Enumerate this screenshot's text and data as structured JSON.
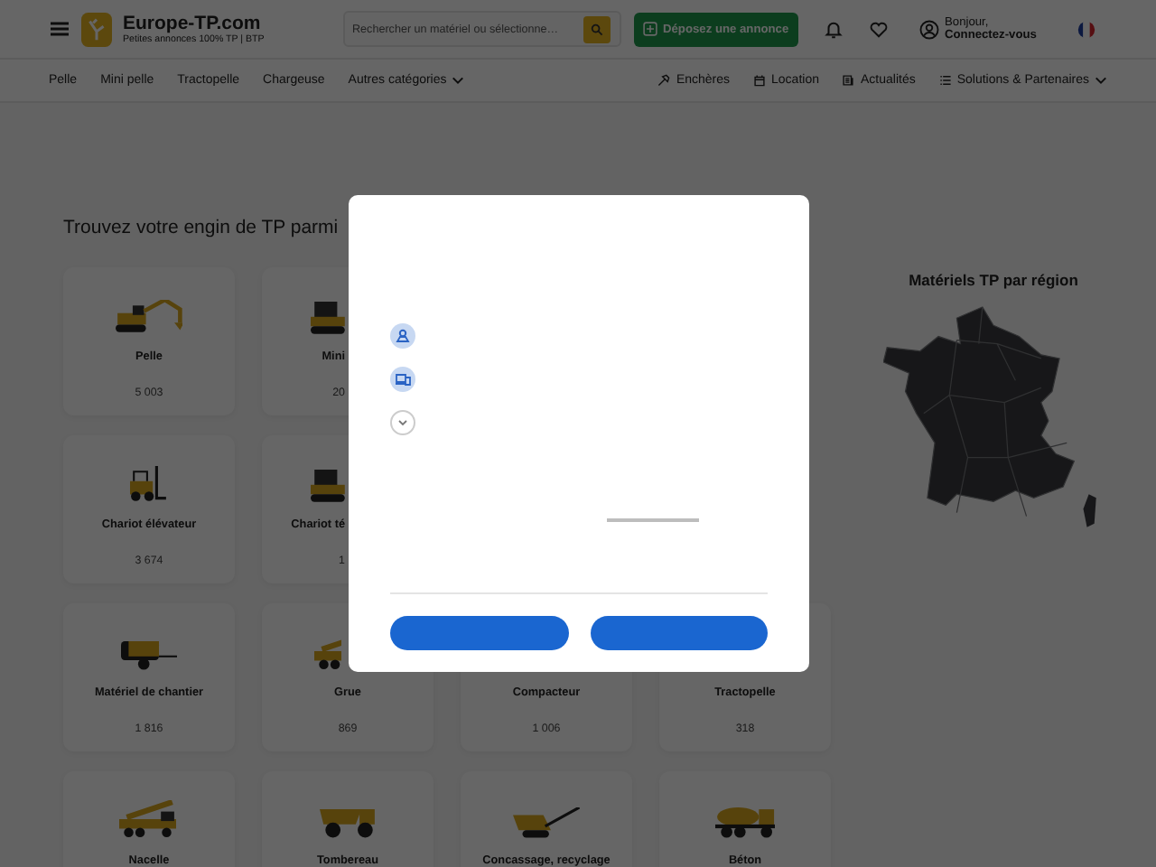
{
  "header": {
    "logo_title": "Europe-TP.com",
    "logo_subtitle": "Petites annonces 100% TP | BTP",
    "search": {
      "placeholder": "Rechercher un matériel ou sélectionne…"
    },
    "post_button": "Déposez une annonce",
    "greeting": "Bonjour,",
    "login": "Connectez-vous"
  },
  "nav": {
    "left": [
      {
        "label": "Pelle",
        "dropdown": false
      },
      {
        "label": "Mini pelle",
        "dropdown": false
      },
      {
        "label": "Tractopelle",
        "dropdown": false
      },
      {
        "label": "Chargeuse",
        "dropdown": false
      },
      {
        "label": "Autres catégories",
        "dropdown": true
      }
    ],
    "right": [
      {
        "label": "Enchères",
        "dropdown": false
      },
      {
        "label": "Location",
        "dropdown": false
      },
      {
        "label": "Actualités",
        "dropdown": false
      },
      {
        "label": "Solutions & Partenaires",
        "dropdown": true
      }
    ]
  },
  "heading": "Trouvez votre engin de TP parmi",
  "category_rows": [
    [
      {
        "name": "Pelle",
        "count": "5 003",
        "kind": "full"
      },
      {
        "name": "Mini",
        "count": "20",
        "kind": "partial"
      }
    ],
    [
      {
        "name": "Chariot élévateur",
        "count": "3 674",
        "kind": "full"
      },
      {
        "name": "Chariot té",
        "count": "1",
        "kind": "partial"
      }
    ],
    [
      {
        "name": "Matériel de chantier",
        "count": "1 816",
        "kind": "full"
      },
      {
        "name": "Grue",
        "count": "869",
        "kind": "full"
      },
      {
        "name": "Compacteur",
        "count": "1 006",
        "kind": "full"
      },
      {
        "name": "Tractopelle",
        "count": "318",
        "kind": "full"
      }
    ],
    [
      {
        "name": "Nacelle",
        "kind": "full"
      },
      {
        "name": "Tombereau",
        "kind": "full"
      },
      {
        "name": "Concassage, recyclage",
        "kind": "full"
      },
      {
        "name": "Béton",
        "kind": "full"
      }
    ]
  ],
  "map_panel": {
    "title": "Matériels TP par région"
  }
}
